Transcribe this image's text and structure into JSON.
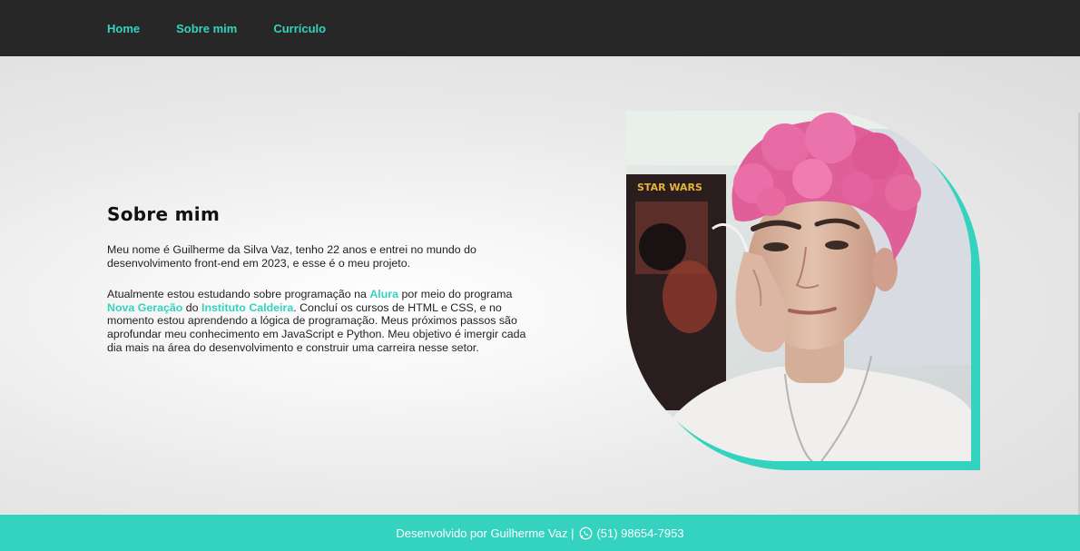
{
  "nav": {
    "items": [
      {
        "label": "Home"
      },
      {
        "label": "Sobre mim"
      },
      {
        "label": "Currículo"
      }
    ]
  },
  "about": {
    "title": "Sobre mim",
    "p1": "Meu nome é Guilherme da Silva Vaz, tenho 22 anos e entrei no mundo do desenvolvimento front-end em 2023, e esse é o meu projeto.",
    "p2_a": "Atualmente estou estudando sobre programação na ",
    "p2_link1": "Alura",
    "p2_b": " por meio do programa ",
    "p2_link2": "Nova Geração",
    "p2_c": " do ",
    "p2_link3": "Instituto Caldeira",
    "p2_d": ". Concluí os cursos de HTML e CSS, e no momento estou aprendendo a lógica de programação. Meus próximos passos são aprofundar meu conhecimento em JavaScript e Python. Meu objetivo é imergir cada dia mais na área do desenvolvimento e construir uma carreira nesse setor."
  },
  "photo": {
    "poster_text": "STAR WARS"
  },
  "footer": {
    "text": "Desenvolvido por Guilherme Vaz |",
    "phone": "(51) 98654-7953",
    "icon": "whatsapp-icon"
  },
  "colors": {
    "accent": "#33d3c0",
    "navbar": "#272727",
    "hair": "#e8609c"
  }
}
